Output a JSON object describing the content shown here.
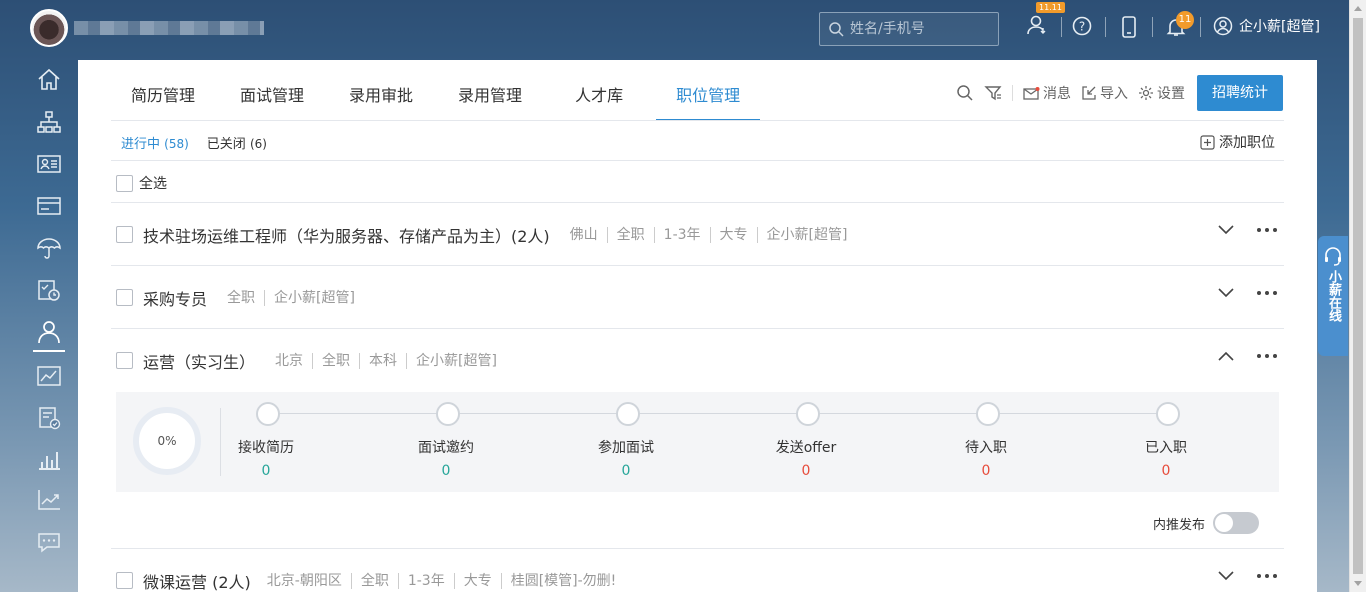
{
  "header": {
    "search_placeholder": "姓名/手机号",
    "badge_1111": "11.11",
    "bell_count": "11",
    "user_name": "企小薪[超管]"
  },
  "tabs": [
    {
      "label": "简历管理"
    },
    {
      "label": "面试管理"
    },
    {
      "label": "录用审批"
    },
    {
      "label": "录用管理"
    },
    {
      "label": "人才库"
    },
    {
      "label": "职位管理"
    }
  ],
  "toolbar": {
    "message": "消息",
    "import": "导入",
    "settings": "设置",
    "stats_button": "招聘统计"
  },
  "subtabs": {
    "open_label": "进行中",
    "open_count": "(58)",
    "closed_label": "已关闭",
    "closed_count": "(6)",
    "add_position": "添加职位"
  },
  "select_all": "全选",
  "jobs": [
    {
      "title": "技术驻场运维工程师（华为服务器、存储产品为主）(2人)",
      "meta": [
        "佛山",
        "全职",
        "1-3年",
        "大专",
        "企小薪[超管]"
      ]
    },
    {
      "title": "采购专员",
      "meta": [
        "全职",
        "企小薪[超管]"
      ]
    },
    {
      "title": "运营（实习生）",
      "meta": [
        "北京",
        "全职",
        "本科",
        "企小薪[超管]"
      ]
    },
    {
      "title": "微课运营 (2人)",
      "meta": [
        "北京-朝阳区",
        "全职",
        "1-3年",
        "大专",
        "桂圆[模管]-勿删!"
      ]
    }
  ],
  "funnel": {
    "percent": "0%",
    "stages": [
      {
        "label": "接收简历",
        "value": "0"
      },
      {
        "label": "面试邀约",
        "value": "0"
      },
      {
        "label": "参加面试",
        "value": "0"
      },
      {
        "label": "发送offer",
        "value": "0"
      },
      {
        "label": "待入职",
        "value": "0"
      },
      {
        "label": "已入职",
        "value": "0"
      }
    ],
    "colors": {
      "teal": "#26a69a",
      "red": "#e74c3c"
    }
  },
  "internal_publish": "内推发布",
  "online_service": "小薪在线",
  "colors": {
    "accent": "#2e8bd1",
    "header_bg": "#2d4f75"
  }
}
